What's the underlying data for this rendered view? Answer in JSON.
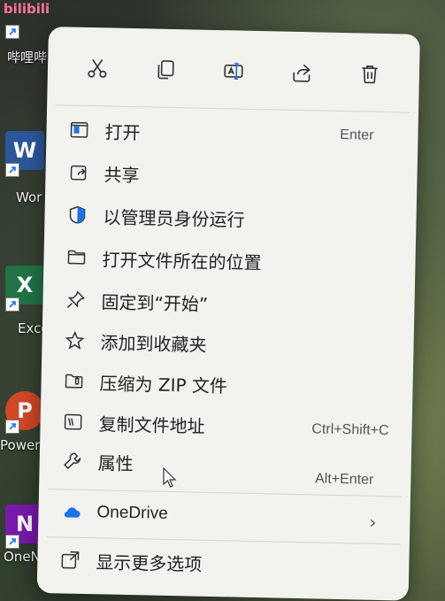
{
  "desktop": {
    "icons": [
      {
        "name": "bilibili",
        "label": "哔哩哔",
        "tile_text": "bilibili",
        "color": "#fb7299"
      },
      {
        "name": "word",
        "label": "Wor",
        "tile_text": "W",
        "color": "#2b579a"
      },
      {
        "name": "excel",
        "label": "Exce",
        "tile_text": "X",
        "color": "#217346"
      },
      {
        "name": "powerpoint",
        "label": "PowerP",
        "tile_text": "P",
        "color": "#d24726"
      },
      {
        "name": "onenote",
        "label": "OneN",
        "tile_text": "N",
        "color": "#7719aa"
      }
    ]
  },
  "context_menu": {
    "toolbar": [
      {
        "name": "cut",
        "icon": "scissors-icon"
      },
      {
        "name": "copy",
        "icon": "copy-icon"
      },
      {
        "name": "rename",
        "icon": "rename-icon"
      },
      {
        "name": "share",
        "icon": "share-icon"
      },
      {
        "name": "delete",
        "icon": "trash-icon"
      }
    ],
    "items": [
      {
        "label": "打开",
        "accelerator": "Enter",
        "icon": "open-icon"
      },
      {
        "label": "共享",
        "accelerator": "",
        "icon": "share-icon"
      },
      {
        "label": "以管理员身份运行",
        "accelerator": "",
        "icon": "shield-icon"
      },
      {
        "label": "打开文件所在的位置",
        "accelerator": "",
        "icon": "folder-icon"
      },
      {
        "label": "固定到“开始”",
        "accelerator": "",
        "icon": "pin-icon"
      },
      {
        "label": "添加到收藏夹",
        "accelerator": "",
        "icon": "star-icon"
      },
      {
        "label": "压缩为 ZIP 文件",
        "accelerator": "",
        "icon": "zip-folder-icon"
      },
      {
        "label": "复制文件地址",
        "accelerator": "Ctrl+Shift+C",
        "icon": "copy-path-icon"
      },
      {
        "label": "属性",
        "accelerator": "Alt+Enter",
        "icon": "wrench-icon"
      },
      {
        "label": "OneDrive",
        "accelerator": "",
        "icon": "cloud-icon",
        "submenu": "›"
      },
      {
        "label": "显示更多选项",
        "accelerator": "",
        "icon": "more-options-icon"
      }
    ]
  }
}
